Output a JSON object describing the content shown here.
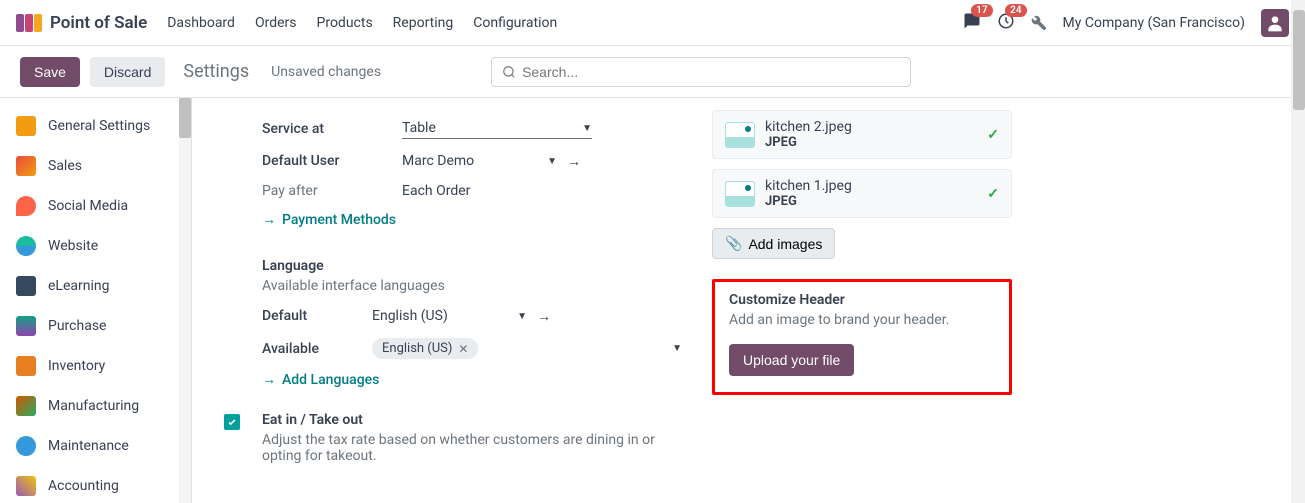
{
  "header": {
    "app_title": "Point of Sale",
    "nav": [
      "Dashboard",
      "Orders",
      "Products",
      "Reporting",
      "Configuration"
    ],
    "msg_badge": "17",
    "activity_badge": "24",
    "company": "My Company (San Francisco)"
  },
  "actionbar": {
    "save": "Save",
    "discard": "Discard",
    "title": "Settings",
    "unsaved": "Unsaved changes",
    "search_placeholder": "Search..."
  },
  "sidebar": {
    "items": [
      {
        "label": "General Settings",
        "color": "#f39c12"
      },
      {
        "label": "Sales",
        "color": "#e74c3c"
      },
      {
        "label": "Social Media",
        "color": "#ff6347"
      },
      {
        "label": "Website",
        "color": "#1abc9c"
      },
      {
        "label": "eLearning",
        "color": "#34495e"
      },
      {
        "label": "Purchase",
        "color": "#16a085"
      },
      {
        "label": "Inventory",
        "color": "#e67e22"
      },
      {
        "label": "Manufacturing",
        "color": "#d35400"
      },
      {
        "label": "Maintenance",
        "color": "#3498db"
      },
      {
        "label": "Accounting",
        "color": "#9b59b6"
      }
    ]
  },
  "settings": {
    "service_at_label": "Service at",
    "service_at_value": "Table",
    "default_user_label": "Default User",
    "default_user_value": "Marc Demo",
    "pay_after_label": "Pay after",
    "pay_after_value": "Each Order",
    "payment_methods_link": "Payment Methods",
    "language_title": "Language",
    "language_desc": "Available interface languages",
    "default_label": "Default",
    "default_value": "English (US)",
    "available_label": "Available",
    "available_tag": "English (US)",
    "add_languages_link": "Add Languages",
    "eatin_title": "Eat in / Take out",
    "eatin_desc": "Adjust the tax rate based on whether customers are dining in or opting for takeout."
  },
  "right": {
    "files": [
      {
        "name": "kitchen 2.jpeg",
        "type": "JPEG"
      },
      {
        "name": "kitchen 1.jpeg",
        "type": "JPEG"
      }
    ],
    "add_images": "Add images",
    "customize_title": "Customize Header",
    "customize_desc": "Add an image to brand your header.",
    "upload_btn": "Upload your file"
  }
}
